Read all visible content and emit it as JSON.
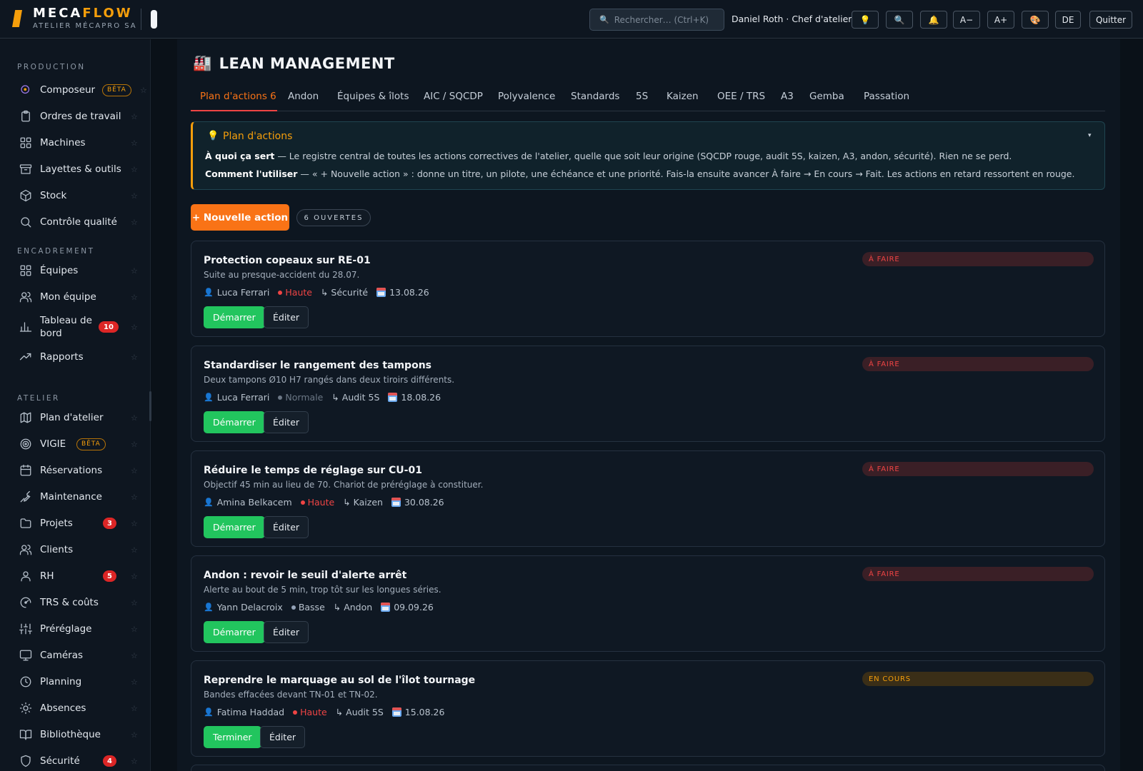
{
  "app": {
    "name_part1": "MECA",
    "name_part2": "FLOW",
    "subtitle": "ATELIER MÉCAPRO SA"
  },
  "header": {
    "search_placeholder": "Rechercher… (Ctrl+K)",
    "search_icon": "magnifier-icon",
    "user": "Daniel Roth · Chef d'atelier",
    "buttons": [
      {
        "label": "💡",
        "name": "tips-icon"
      },
      {
        "label": "🔍",
        "name": "zoom-icon"
      },
      {
        "label": "🔔",
        "name": "bell-icon"
      },
      {
        "label": "A−",
        "name": "font-decrease"
      },
      {
        "label": "A+",
        "name": "font-increase"
      },
      {
        "label": "🎨",
        "name": "palette-icon"
      },
      {
        "label": "DE",
        "name": "language"
      },
      {
        "label": "Quitter",
        "name": "quit"
      }
    ]
  },
  "sidebar": {
    "sections": [
      {
        "title": "PRODUCTION",
        "items": [
          {
            "label": "Composeur",
            "icon": "sparkle-icon",
            "beta": "BÊTA"
          },
          {
            "label": "Ordres de travail",
            "icon": "clipboard-icon"
          },
          {
            "label": "Machines",
            "icon": "grid-icon"
          },
          {
            "label": "Layettes & outils",
            "icon": "archive-icon"
          },
          {
            "label": "Stock",
            "icon": "box-icon"
          },
          {
            "label": "Contrôle qualité",
            "icon": "search-icon"
          }
        ]
      },
      {
        "title": "ENCADREMENT",
        "items": [
          {
            "label": "Équipes",
            "icon": "grid-icon"
          },
          {
            "label": "Mon équipe",
            "icon": "users-icon"
          },
          {
            "label": "Tableau de bord",
            "icon": "bar-chart-icon",
            "badge": "10"
          },
          {
            "label": "Rapports",
            "icon": "trend-icon"
          }
        ]
      },
      {
        "title": "ATELIER",
        "items": [
          {
            "label": "Plan d'atelier",
            "icon": "map-icon"
          },
          {
            "label": "VIGIE",
            "icon": "target-icon",
            "beta": "BÊTA"
          },
          {
            "label": "Réservations",
            "icon": "calendar-icon"
          },
          {
            "label": "Maintenance",
            "icon": "wrench-icon"
          },
          {
            "label": "Projets",
            "icon": "folder-icon",
            "badge": "3"
          },
          {
            "label": "Clients",
            "icon": "users-icon"
          },
          {
            "label": "RH",
            "icon": "user-icon",
            "badge": "5"
          },
          {
            "label": "TRS & coûts",
            "icon": "gauge-icon"
          },
          {
            "label": "Préréglage",
            "icon": "sliders-icon"
          },
          {
            "label": "Caméras",
            "icon": "monitor-icon"
          },
          {
            "label": "Planning",
            "icon": "clock-icon"
          },
          {
            "label": "Absences",
            "icon": "sun-icon"
          },
          {
            "label": "Bibliothèque",
            "icon": "book-icon"
          },
          {
            "label": "Sécurité",
            "icon": "shield-icon",
            "badge": "4"
          }
        ]
      }
    ],
    "star_glyph": "☆"
  },
  "page": {
    "icon": "🏭",
    "title": "LEAN MANAGEMENT",
    "tabs": [
      "Plan d'actions 6",
      "Andon",
      "Équipes & îlots",
      "AIC / SQCDP",
      "Polyvalence",
      "Standards",
      "5S",
      "Kaizen",
      "OEE / TRS",
      "A3",
      "Gemba",
      "Passation"
    ],
    "active_tab": 0
  },
  "info": {
    "icon": "💡",
    "title": "Plan d'actions",
    "caret": "▾",
    "what_label": "À quoi ça sert",
    "what_text": " — Le registre central de toutes les actions correctives de l'atelier, quelle que soit leur origine (SQCDP rouge, audit 5S, kaizen, A3, andon, sécurité). Rien ne se perd.",
    "how_label": "Comment l'utiliser",
    "how_text": " — « + Nouvelle action » : donne un titre, un pilote, une échéance et une priorité. Fais-la ensuite avancer À faire → En cours → Fait. Les actions en retard ressortent en rouge."
  },
  "actions_bar": {
    "new_action": "+ Nouvelle action",
    "open_count": "6 OUVERTES"
  },
  "actions": [
    {
      "title": "Protection copeaux sur RE-01",
      "desc": "Suite au presque-accident du 28.07.",
      "pilot": "Luca Ferrari",
      "priority": "Haute",
      "priority_color": "#ef4444",
      "origin": "↳ Sécurité",
      "due": "13.08.26",
      "status": "À FAIRE",
      "status_kind": "todo",
      "primary": "Démarrer",
      "edit": "Éditer"
    },
    {
      "title": "Standardiser le rangement des tampons",
      "desc": "Deux tampons Ø10 H7 rangés dans deux tiroirs différents.",
      "pilot": "Luca Ferrari",
      "priority": "Normale",
      "priority_color": "#6b7785",
      "origin": "↳ Audit 5S",
      "due": "18.08.26",
      "status": "À FAIRE",
      "status_kind": "todo",
      "primary": "Démarrer",
      "edit": "Éditer"
    },
    {
      "title": "Réduire le temps de réglage sur CU-01",
      "desc": "Objectif 45 min au lieu de 70. Chariot de préréglage à constituer.",
      "pilot": "Amina Belkacem",
      "priority": "Haute",
      "priority_color": "#ef4444",
      "origin": "↳ Kaizen",
      "due": "30.08.26",
      "status": "À FAIRE",
      "status_kind": "todo",
      "primary": "Démarrer",
      "edit": "Éditer"
    },
    {
      "title": "Andon : revoir le seuil d'alerte arrêt",
      "desc": "Alerte au bout de 5 min, trop tôt sur les longues séries.",
      "pilot": "Yann Delacroix",
      "priority": "Basse",
      "priority_color": "#94a3b8",
      "origin": "↳ Andon",
      "due": "09.09.26",
      "status": "À FAIRE",
      "status_kind": "todo",
      "primary": "Démarrer",
      "edit": "Éditer"
    },
    {
      "title": "Reprendre le marquage au sol de l'îlot tournage",
      "desc": "Bandes effacées devant TN-01 et TN-02.",
      "pilot": "Fatima Haddad",
      "priority": "Haute",
      "priority_color": "#ef4444",
      "origin": "↳ Audit 5S",
      "due": "15.08.26",
      "status": "EN COURS",
      "status_kind": "doing",
      "primary": "Terminer",
      "edit": "Éditer"
    }
  ],
  "colors": {
    "accent": "#f97316",
    "brand": "#f59e0b",
    "success": "#22c55e",
    "danger": "#dc2626"
  }
}
